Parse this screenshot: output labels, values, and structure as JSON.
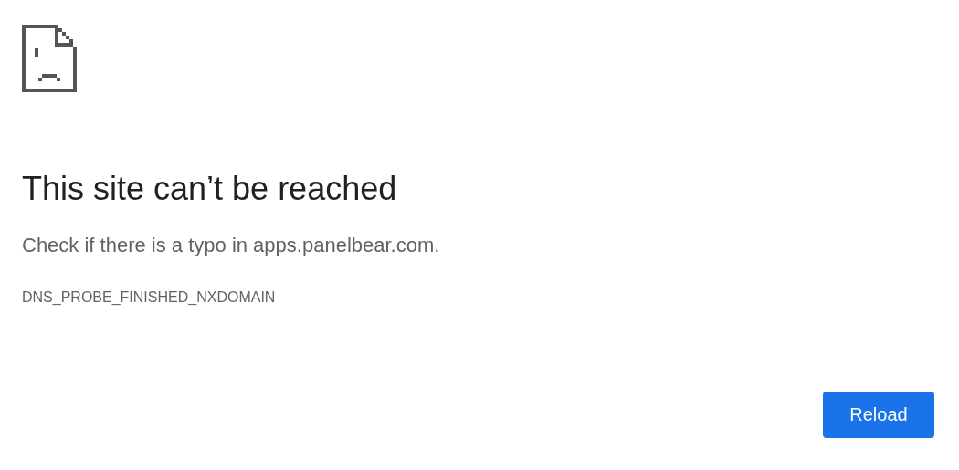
{
  "heading": "This site can’t be reached",
  "message": "Check if there is a typo in apps.panelbear.com.",
  "error_code": "DNS_PROBE_FINISHED_NXDOMAIN",
  "buttons": [
    {
      "label": "Reload"
    }
  ]
}
